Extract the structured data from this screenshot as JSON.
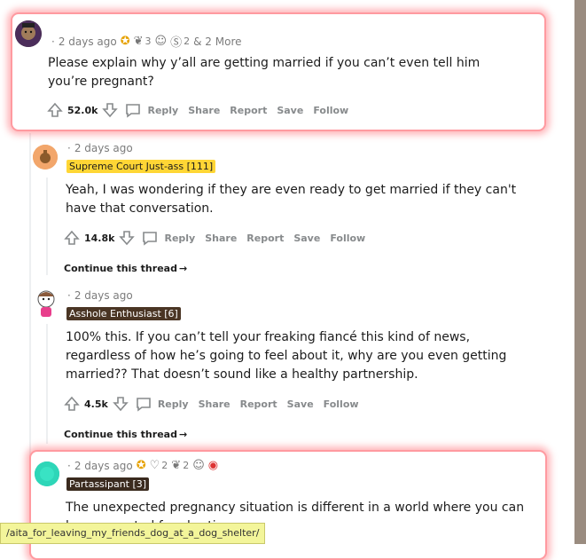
{
  "comments": [
    {
      "time": "2 days ago",
      "awards": [
        {
          "icon": "star-award-icon",
          "count": ""
        },
        {
          "icon": "award-icon",
          "count": "3"
        },
        {
          "icon": "award-icon",
          "count": ""
        },
        {
          "icon": "award-icon",
          "count": "2"
        }
      ],
      "more": "& 2 More",
      "flair": "",
      "text": "Please explain why y’all are getting married if you can’t even tell him you’re pregnant?",
      "score": "52.0k"
    },
    {
      "time": "2 days ago",
      "flair": "Supreme Court Just-ass [111]",
      "text": "Yeah, I was wondering if they are even ready to get married if they can't have that conversation.",
      "score": "14.8k"
    },
    {
      "time": "2 days ago",
      "flair": "Asshole Enthusiast [6]",
      "text": "100% this. If you can’t tell your freaking fiancé this kind of news, regardless of how he’s going to feel about it, why are you even getting married?? That doesn’t sound like a healthy partnership.",
      "score": "4.5k"
    },
    {
      "time": "2 days ago",
      "awards": [
        {
          "icon": "star-award-icon",
          "count": ""
        },
        {
          "icon": "award-icon",
          "count": "2"
        },
        {
          "icon": "award-icon",
          "count": "2"
        },
        {
          "icon": "award-icon",
          "count": ""
        },
        {
          "icon": "award-icon",
          "count": ""
        }
      ],
      "flair": "Partassipant [3]",
      "text": "The unexpected pregnancy situation is different in a world where you can be prosecuted for abortion",
      "score": ""
    }
  ],
  "actions": {
    "reply": "Reply",
    "share": "Share",
    "report": "Report",
    "save": "Save",
    "follow": "Follow"
  },
  "continue_thread": "Continue this thread",
  "status_url": "/aita_for_leaving_my_friends_dog_at_a_dog_shelter/",
  "colors": {
    "highlight": "#ff9aa0",
    "flair1_bg": "#ffd635",
    "flair_dark_bg": "#4a3524",
    "accent": "#0079d3"
  }
}
